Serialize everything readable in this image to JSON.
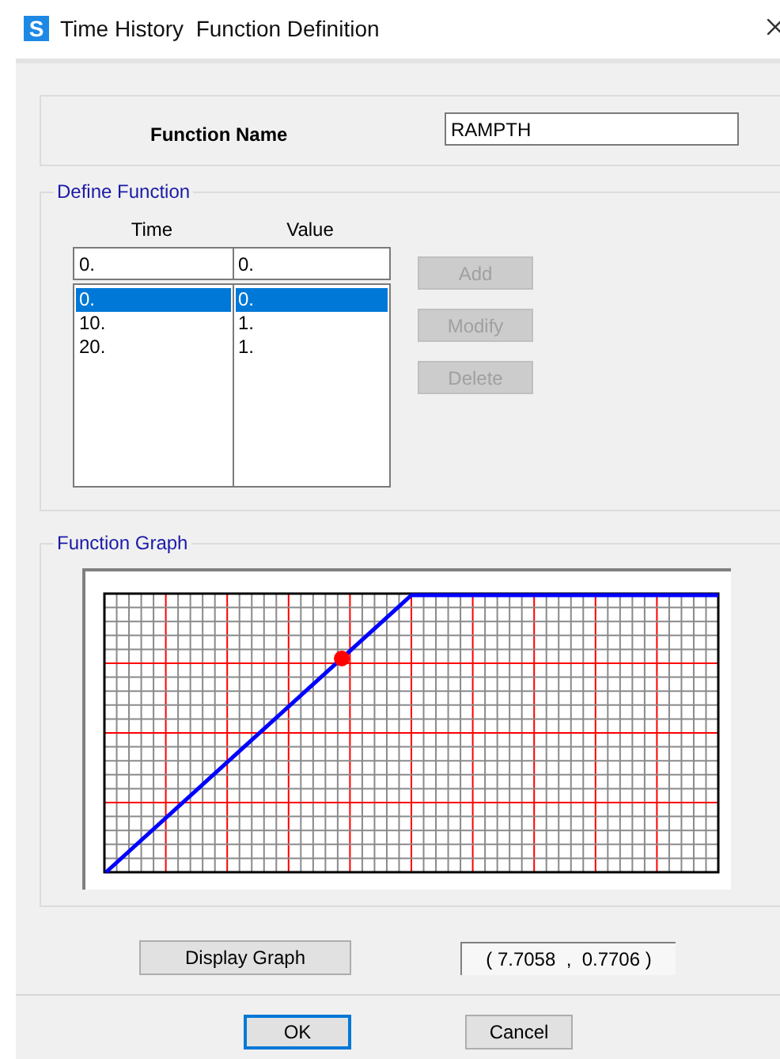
{
  "window": {
    "title": "Time History  Function Definition",
    "app_icon": "S"
  },
  "function_name": {
    "label": "Function Name",
    "value": "RAMPTH"
  },
  "define_function": {
    "title": "Define Function",
    "columns": [
      "Time",
      "Value"
    ],
    "inputs": [
      "0.",
      "0."
    ],
    "rows": [
      {
        "cells": [
          "0.",
          "0."
        ],
        "selected": true
      },
      {
        "cells": [
          "10.",
          "1."
        ],
        "selected": false
      },
      {
        "cells": [
          "20.",
          "1."
        ],
        "selected": false
      }
    ],
    "buttons": [
      {
        "label": "Add",
        "disabled": true
      },
      {
        "label": "Modify",
        "disabled": true
      },
      {
        "label": "Delete",
        "disabled": true
      }
    ]
  },
  "function_graph": {
    "title": "Function Graph",
    "display_button": "Display Graph",
    "readout": "( 7.7058  ,  0.7706 )"
  },
  "buttons": [
    {
      "label": "OK",
      "default": true
    },
    {
      "label": "Cancel",
      "default": false
    }
  ]
}
